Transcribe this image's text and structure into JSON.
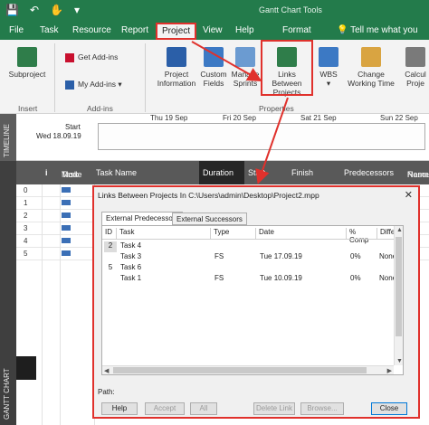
{
  "titlebar": {
    "context_label": "Gantt Chart Tools"
  },
  "tabs": [
    "File",
    "Task",
    "Resource",
    "Report",
    "Project",
    "View",
    "Help",
    "Format"
  ],
  "tell_me": "Tell me what you",
  "ribbon": {
    "insert": {
      "subproject": "Subproject",
      "label": "Insert"
    },
    "addins": {
      "get_addins": "Get Add-ins",
      "my_addins": "My Add-ins",
      "label": "Add-ins"
    },
    "properties": {
      "project_information": [
        "Project",
        "Information"
      ],
      "custom_fields": [
        "Custom",
        "Fields"
      ],
      "manage_sprints": [
        "Manage",
        "Sprints"
      ],
      "links_between_projects": [
        "Links Between",
        "Projects"
      ],
      "wbs": "WBS",
      "change_working_time": [
        "Change",
        "Working Time"
      ],
      "calculate": [
        "Calcul",
        "Proje"
      ],
      "label": "Properties"
    }
  },
  "timeline": {
    "side_label": "TIMELINE",
    "start_label": "Start",
    "start_date": "Wed 18.09.19",
    "dates": [
      "Thu 19 Sep",
      "Fri 20 Sep",
      "Sat 21 Sep",
      "Sun 22 Sep"
    ]
  },
  "gantt": {
    "side_label": "GANTT CHART",
    "headers": {
      "info": "i",
      "task_mode": [
        "Task",
        "Mode"
      ],
      "task_name": "Task Name",
      "duration": "Duration",
      "start": "Start",
      "finish": "Finish",
      "predecessors": "Predecessors",
      "resource": [
        "Resou",
        "Name"
      ]
    },
    "row_numbers": [
      "0",
      "1",
      "2",
      "3",
      "4",
      "5"
    ]
  },
  "dialog": {
    "title": "Links Between Projects In C:\\Users\\admin\\Desktop\\Project2.mpp",
    "close_glyph": "✕",
    "tabs": [
      "External Predecessors",
      "External Successors"
    ],
    "columns": [
      "ID",
      "Task",
      "Type",
      "Date",
      "% Comp",
      "Differe"
    ],
    "rows": [
      {
        "id": "2",
        "task": "Task 4",
        "type": "",
        "date": "",
        "comp": "",
        "diff": "",
        "selected": true
      },
      {
        "id": "",
        "task": "Task 3",
        "type": "FS",
        "date": "Tue 17.09.19",
        "comp": "0%",
        "diff": "None"
      },
      {
        "id": "5",
        "task": "Task 6",
        "type": "",
        "date": "",
        "comp": "",
        "diff": ""
      },
      {
        "id": "",
        "task": "Task 1",
        "type": "FS",
        "date": "Tue 10.09.19",
        "comp": "0%",
        "diff": "None"
      }
    ],
    "path_label": "Path:",
    "buttons": {
      "help": "Help",
      "accept": "Accept",
      "all": "All",
      "delete_link": "Delete Link",
      "browse": "Browse...",
      "close": "Close"
    }
  },
  "colors": {
    "accent": "#237b4b",
    "highlight": "#e0312c",
    "gantt_header": "#595959"
  }
}
